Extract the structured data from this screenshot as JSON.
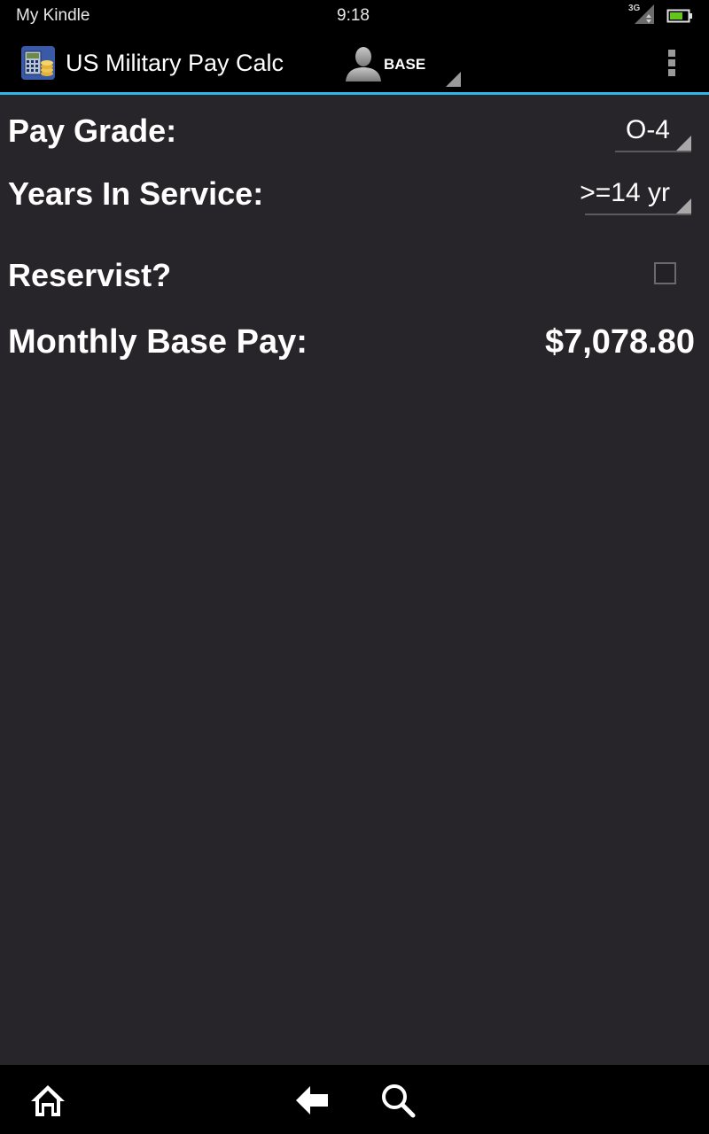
{
  "status_bar": {
    "device_label": "My Kindle",
    "time": "9:18",
    "network": "3G",
    "icons": [
      "signal-icon",
      "battery-icon"
    ]
  },
  "action_bar": {
    "app_title": "US Military Pay Calc",
    "mode_label": "BASE",
    "icons": [
      "app-icon",
      "person-icon",
      "overflow-menu-icon"
    ],
    "accent_color": "#33b5e5"
  },
  "form": {
    "pay_grade_label": "Pay Grade:",
    "pay_grade_value": "O-4",
    "years_label": "Years In Service:",
    "years_value": ">=14 yr",
    "reservist_label": "Reservist?",
    "reservist_checked": false,
    "monthly_pay_label": "Monthly Base Pay:",
    "monthly_pay_value": "$7,078.80"
  },
  "bottom_nav": {
    "icons": [
      "home-icon",
      "back-icon",
      "search-icon"
    ]
  }
}
